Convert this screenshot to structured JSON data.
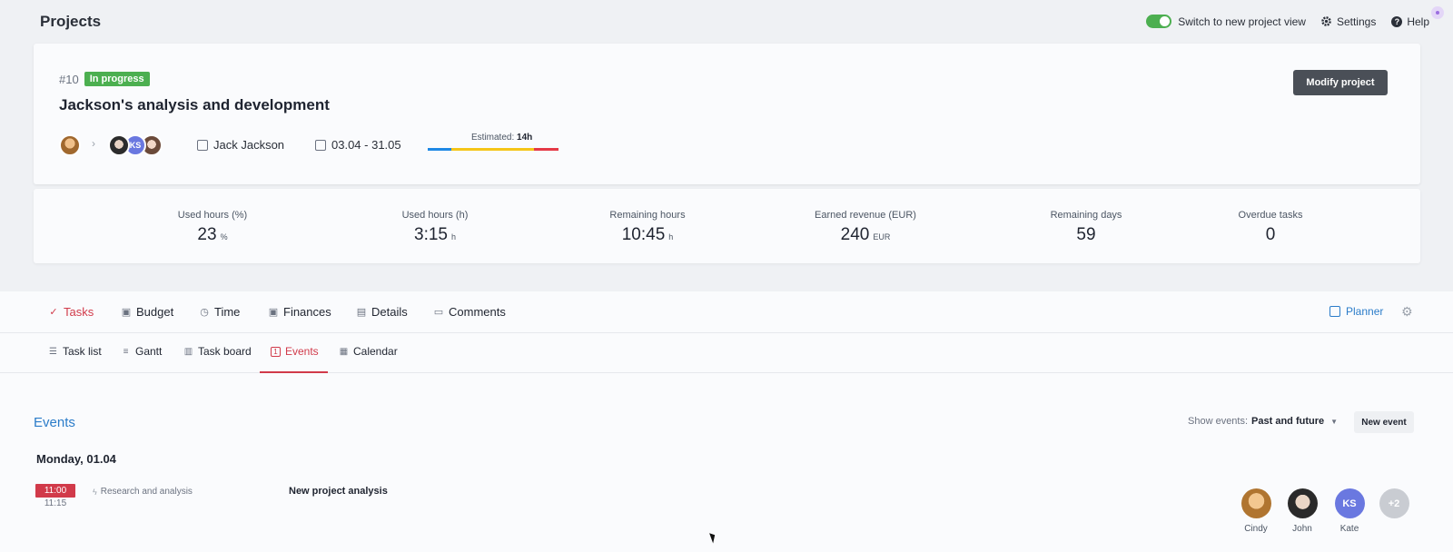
{
  "header": {
    "title": "Projects",
    "toggle_label": "Switch to new project view",
    "settings_label": "Settings",
    "help_label": "Help"
  },
  "project": {
    "number": "#10",
    "status": "In progress",
    "name": "Jackson's analysis and development",
    "modify_label": "Modify project",
    "owner_avatar": "avatar-photo",
    "team_initials": "KS",
    "client": "Jack Jackson",
    "date_range": "03.04 - 31.05",
    "estimate_label": "Estimated:",
    "estimate_value": "14h",
    "progress_colors": [
      "#1e88e5",
      "#f5c518",
      "#e53946"
    ],
    "progress_fractions": [
      0.18,
      0.63,
      0.19
    ]
  },
  "stats": [
    {
      "label": "Used hours (%)",
      "value": "23",
      "unit": "%"
    },
    {
      "label": "Used hours (h)",
      "value": "3:15",
      "unit": "h"
    },
    {
      "label": "Remaining hours",
      "value": "10:45",
      "unit": "h"
    },
    {
      "label": "Earned revenue (EUR)",
      "value": "240",
      "unit": "EUR"
    },
    {
      "label": "Remaining days",
      "value": "59",
      "unit": ""
    },
    {
      "label": "Overdue tasks",
      "value": "0",
      "unit": ""
    }
  ],
  "tabs": [
    {
      "label": "Tasks",
      "icon": "tasks-icon",
      "active": true
    },
    {
      "label": "Budget",
      "icon": "budget-icon",
      "active": false
    },
    {
      "label": "Time",
      "icon": "clock-icon",
      "active": false
    },
    {
      "label": "Finances",
      "icon": "finances-icon",
      "active": false
    },
    {
      "label": "Details",
      "icon": "document-icon",
      "active": false
    },
    {
      "label": "Comments",
      "icon": "comment-icon",
      "active": false
    }
  ],
  "planner_label": "Planner",
  "subtabs": [
    {
      "label": "Task list",
      "icon": "list-icon",
      "active": false
    },
    {
      "label": "Gantt",
      "icon": "gantt-icon",
      "active": false
    },
    {
      "label": "Task board",
      "icon": "board-icon",
      "active": false
    },
    {
      "label": "Events",
      "icon": "event-icon",
      "active": true
    },
    {
      "label": "Calendar",
      "icon": "calendar-icon",
      "active": false
    }
  ],
  "events": {
    "title": "Events",
    "filter_label": "Show events:",
    "filter_value": "Past and future",
    "new_event_label": "New event",
    "day_heading": "Monday, 01.04",
    "items": [
      {
        "start": "11:00",
        "end": "11:15",
        "type": "Research and analysis",
        "title": "New project analysis",
        "participants": [
          {
            "name": "Cindy",
            "initials": ""
          },
          {
            "name": "John",
            "initials": ""
          },
          {
            "name": "Kate",
            "initials": "KS"
          },
          {
            "name": "",
            "initials": "+2"
          }
        ]
      }
    ]
  },
  "colors": {
    "accent": "#d13a4a",
    "link": "#2b7cc9",
    "status_green": "#4caf50",
    "primary_button": "#4a4f57"
  }
}
